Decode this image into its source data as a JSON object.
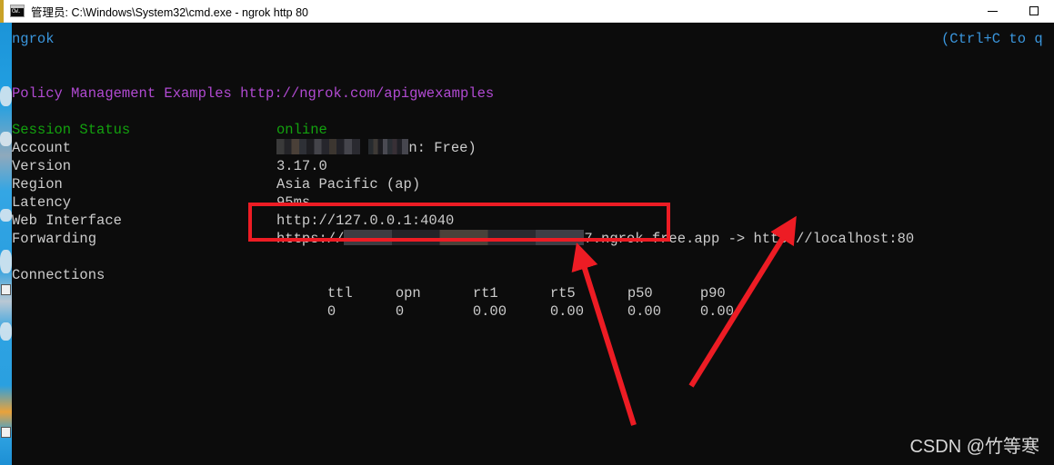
{
  "window": {
    "title": "管理员: C:\\Windows\\System32\\cmd.exe - ngrok  http 80",
    "icon_name": "cmd-console-icon",
    "icon_glyph": "CW.",
    "controls": {
      "minimize_label": "Minimize",
      "maximize_label": "Maximize"
    }
  },
  "console": {
    "brand": "ngrok",
    "ctrl_hint": "(Ctrl+C to q",
    "banner": "Policy Management Examples http://ngrok.com/apigwexamples",
    "session": {
      "rows": [
        {
          "label": "Session Status",
          "value": "online",
          "label_color": "#13a10e",
          "value_color": "#13a10e",
          "redacted": false
        },
        {
          "label": "Account",
          "value": "n: Free)",
          "label_color": "#cccccc",
          "value_color": "#cccccc",
          "redacted": true
        },
        {
          "label": "Version",
          "value": "3.17.0",
          "label_color": "#cccccc",
          "value_color": "#cccccc",
          "redacted": false
        },
        {
          "label": "Region",
          "value": "Asia Pacific (ap)",
          "label_color": "#cccccc",
          "value_color": "#cccccc",
          "redacted": false
        },
        {
          "label": "Latency",
          "value": "95ms",
          "label_color": "#cccccc",
          "value_color": "#cccccc",
          "redacted": false
        },
        {
          "label": "Web Interface",
          "value": "http://127.0.0.1:4040",
          "label_color": "#cccccc",
          "value_color": "#cccccc",
          "redacted": false
        },
        {
          "label": "Forwarding",
          "value": "",
          "label_color": "#cccccc",
          "value_color": "#cccccc",
          "redacted": true
        }
      ],
      "forwarding": {
        "scheme": "https://",
        "host_suffix": "7.ngrok-free.app",
        "arrow": "->",
        "target": "http://localhost:80"
      }
    },
    "connections": {
      "label": "Connections",
      "headers": [
        "ttl",
        "opn",
        "rt1",
        "rt5",
        "p50",
        "p90"
      ],
      "values": [
        "0",
        "0",
        "0.00",
        "0.00",
        "0.00",
        "0.00"
      ]
    }
  },
  "annotations": {
    "box_label": "forwarding-url-highlight",
    "arrow_left_label": "arrow-to-forwarding-box",
    "arrow_right_label": "arrow-to-localhost-target",
    "color": "#ed1c24"
  },
  "watermark": {
    "text": "CSDN @竹等寒"
  }
}
